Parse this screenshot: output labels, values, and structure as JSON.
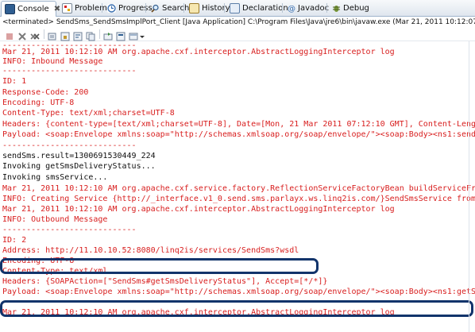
{
  "tabs": [
    {
      "label": "Console",
      "icon": "console-icon",
      "active": true,
      "close": "✖"
    },
    {
      "label": "Problems",
      "icon": "problems-icon"
    },
    {
      "label": "Progress",
      "icon": "progress-icon"
    },
    {
      "label": "Search",
      "icon": "search-icon"
    },
    {
      "label": "History",
      "icon": "history-icon"
    },
    {
      "label": "Declaration",
      "icon": "declaration-icon"
    },
    {
      "label": "Javadoc",
      "icon": "javadoc-icon"
    },
    {
      "label": "Debug",
      "icon": "debug-icon"
    }
  ],
  "status_line": "<terminated> SendSms_SendSmsImplPort_Client [Java Application] C:\\Program Files\\Java\\jre6\\bin\\javaw.exe (Mar 21, 2011 10:12:07 AM)",
  "toolbar_icons": [
    "terminate-icon",
    "remove-launch-icon",
    "remove-all-icon",
    "clear-console-icon",
    "scroll-lock-icon",
    "word-wrap-icon",
    "copy-icon",
    "pin-console-icon",
    "display-console-icon",
    "open-console-icon",
    "dropdown-icon"
  ],
  "colors": {
    "stderr": "#d81e1e",
    "stdout": "#101010",
    "highlight_box": "#12346b",
    "tab_border": "#9fb4cc"
  },
  "console_lines": [
    {
      "text": "----------------------------",
      "style": "err"
    },
    {
      "text": "Mar 21, 2011 10:12:10 AM org.apache.cxf.interceptor.AbstractLoggingInterceptor log",
      "style": "err"
    },
    {
      "text": "INFO: Inbound Message",
      "style": "err"
    },
    {
      "text": "----------------------------",
      "style": "err"
    },
    {
      "text": "ID: 1",
      "style": "err"
    },
    {
      "text": "Response-Code: 200",
      "style": "err"
    },
    {
      "text": "Encoding: UTF-8",
      "style": "err"
    },
    {
      "text": "Content-Type: text/xml;charset=UTF-8",
      "style": "err"
    },
    {
      "text": "Headers: {content-type=[text/xml;charset=UTF-8], Date=[Mon, 21 Mar 2011 07:12:10 GMT], Content-Length=",
      "style": "err"
    },
    {
      "text": "Payload: <soap:Envelope xmlns:soap=\"http://schemas.xmlsoap.org/soap/envelope/\"><soap:Body><ns1:sendSms",
      "style": "err"
    },
    {
      "text": "----------------------------",
      "style": "err"
    },
    {
      "text": "sendSms.result=1300691530449_224",
      "style": "out"
    },
    {
      "text": "Invoking getSmsDeliveryStatus...",
      "style": "out"
    },
    {
      "text": "Invoking smsService...",
      "style": "out"
    },
    {
      "text": "Mar 21, 2011 10:12:10 AM org.apache.cxf.service.factory.ReflectionServiceFactoryBean buildServiceFromC",
      "style": "err"
    },
    {
      "text": "INFO: Creating Service {http://_interface.v1_0.send.sms.parlayx.ws.linq2is.com/}SendSmsService from c",
      "style": "err"
    },
    {
      "text": "Mar 21, 2011 10:12:10 AM org.apache.cxf.interceptor.AbstractLoggingInterceptor log",
      "style": "err"
    },
    {
      "text": "INFO: Outbound Message",
      "style": "err"
    },
    {
      "text": "----------------------------",
      "style": "err"
    },
    {
      "text": "ID: 2",
      "style": "err"
    },
    {
      "text": "Address: http://11.10.10.52:8080/linq2is/services/SendSms?wsdl",
      "style": "err"
    },
    {
      "text": "Encoding: UTF-8",
      "style": "err"
    },
    {
      "text": "Content-Type: text/xml",
      "style": "err"
    },
    {
      "text": "Headers: {SOAPAction=[\"SendSms#getSmsDeliveryStatus\"], Accept=[*/*]}",
      "style": "err"
    },
    {
      "text": "Payload: <soap:Envelope xmlns:soap=\"http://schemas.xmlsoap.org/soap/envelope/\"><soap:Body><ns1:getSms",
      "style": "err"
    },
    {
      "text": "----------------------------",
      "style": "err"
    },
    {
      "text": "Mar 21, 2011 10:12:10 AM org.apache.cxf.interceptor.AbstractLoggingInterceptor log",
      "style": "err"
    }
  ]
}
